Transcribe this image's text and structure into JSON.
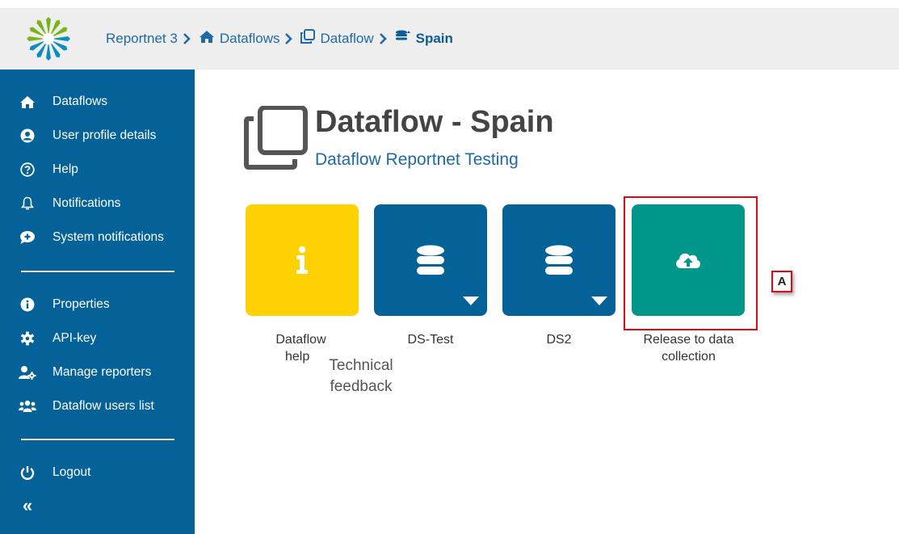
{
  "colors": {
    "sidebar": "#046298",
    "help_card": "#ffd100",
    "dataset_card": "#046298",
    "release_card": "#00968a",
    "highlight": "#e30613",
    "link": "#1e6aa3"
  },
  "breadcrumb": {
    "items": [
      {
        "label": "Reportnet 3",
        "icon": ""
      },
      {
        "label": "Dataflows",
        "icon": "home-icon"
      },
      {
        "label": "Dataflow",
        "icon": "clone-icon"
      },
      {
        "label": "Spain",
        "icon": "database-icon"
      }
    ]
  },
  "sidebar": {
    "items": [
      {
        "label": "Dataflows",
        "icon": "home-icon"
      },
      {
        "label": "User profile details",
        "icon": "user-circle-icon"
      },
      {
        "label": "Help",
        "icon": "question-circle-icon"
      },
      {
        "label": "Notifications",
        "icon": "bell-icon"
      },
      {
        "label": "System notifications",
        "icon": "comment-plus-icon"
      },
      {
        "label": "Properties",
        "icon": "info-circle-icon"
      },
      {
        "label": "API-key",
        "icon": "cog-icon"
      },
      {
        "label": "Manage reporters",
        "icon": "user-cog-icon"
      },
      {
        "label": "Dataflow users list",
        "icon": "users-icon"
      },
      {
        "label": "Logout",
        "icon": "power-icon"
      }
    ],
    "collapse_glyph": "«"
  },
  "main": {
    "title": "Dataflow - Spain",
    "subtitle": "Dataflow Reportnet Testing",
    "cards": [
      {
        "label_line1": "Dataflow",
        "label_line2": "help",
        "icon": "info-icon"
      },
      {
        "label": "DS-Test",
        "icon": "database-icon"
      },
      {
        "label": "DS2",
        "icon": "database-icon"
      },
      {
        "label": "Release to data collection",
        "icon": "cloud-upload-icon"
      }
    ],
    "tooltip": "Technical feedback",
    "marker": "A"
  }
}
